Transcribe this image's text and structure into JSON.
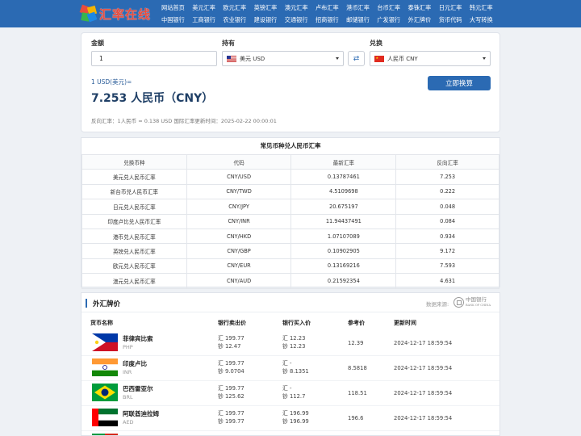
{
  "header": {
    "logo_text": "汇率在线",
    "nav_row1": [
      "网站首页",
      "美元汇率",
      "欧元汇率",
      "英镑汇率",
      "澳元汇率",
      "卢布汇率",
      "港币汇率",
      "台币汇率",
      "泰铢汇率",
      "日元汇率",
      "韩元汇率"
    ],
    "nav_row2": [
      "中国银行",
      "工商银行",
      "农业银行",
      "建设银行",
      "交通银行",
      "招商银行",
      "邮储银行",
      "广发银行",
      "外汇牌价",
      "货币代码",
      "大写转换"
    ]
  },
  "converter": {
    "amount_label": "金额",
    "amount_value": "1",
    "have_label": "持有",
    "have_value": "美元 USD",
    "exchange_label": "兑换",
    "exchange_value": "人民币 CNY",
    "unit_line": "1 USD(美元)=",
    "result": "7.253 人民币（CNY）",
    "convert_button": "立即换算",
    "reverse_line": "反向汇率：1人民币 = 0.138 USD  国际汇率更新时间：2025-02-22 00:00:01"
  },
  "common_rates": {
    "title": "常见币种兑人民币汇率",
    "headers": [
      "兑换币种",
      "代码",
      "最新汇率",
      "反向汇率"
    ],
    "rows": [
      [
        "美元兑人民币汇率",
        "CNY/USD",
        "0.13787461",
        "7.253"
      ],
      [
        "新台币兑人民币汇率",
        "CNY/TWD",
        "4.5109698",
        "0.222"
      ],
      [
        "日元兑人民币汇率",
        "CNY/JPY",
        "20.675197",
        "0.048"
      ],
      [
        "印度卢比兑人民币汇率",
        "CNY/INR",
        "11.94437491",
        "0.084"
      ],
      [
        "港币兑人民币汇率",
        "CNY/HKD",
        "1.07107089",
        "0.934"
      ],
      [
        "英镑兑人民币汇率",
        "CNY/GBP",
        "0.10902905",
        "9.172"
      ],
      [
        "欧元兑人民币汇率",
        "CNY/EUR",
        "0.13169216",
        "7.593"
      ],
      [
        "澳元兑人民币汇率",
        "CNY/AUD",
        "0.21592354",
        "4.631"
      ]
    ]
  },
  "forex": {
    "title": "外汇牌价",
    "source_label": "数据来源:",
    "source_logo": "中国银行",
    "source_logo_en": "BANK OF CHINA",
    "columns": [
      "货币名称",
      "银行卖出价",
      "银行买入价",
      "参考价",
      "更新时间"
    ],
    "rows": [
      {
        "name": "菲律宾比索",
        "code": "PHP",
        "sell_1": "汇 199.77",
        "sell_2": "钞 12.47",
        "buy_1": "汇 12.23",
        "buy_2": "钞 12.23",
        "ref": "12.39",
        "time": "2024-12-17 18:59:54",
        "flag": "php"
      },
      {
        "name": "印度卢比",
        "code": "INR",
        "sell_1": "汇 199.77",
        "sell_2": "钞 9.0704",
        "buy_1": "汇 -",
        "buy_2": "钞 8.1351",
        "ref": "8.5818",
        "time": "2024-12-17 18:59:54",
        "flag": "inr"
      },
      {
        "name": "巴西雷亚尔",
        "code": "BRL",
        "sell_1": "汇 199.77",
        "sell_2": "钞 125.62",
        "buy_1": "汇 -",
        "buy_2": "钞 112.7",
        "ref": "118.51",
        "time": "2024-12-17 18:59:54",
        "flag": "brl"
      },
      {
        "name": "阿联酋迪拉姆",
        "code": "AED",
        "sell_1": "汇 199.77",
        "sell_2": "钞 199.77",
        "buy_1": "汇 196.99",
        "buy_2": "钞 196.99",
        "ref": "196.6",
        "time": "2024-12-17 18:59:54",
        "flag": "aed"
      }
    ]
  },
  "colors": {
    "primary": "#2b6ab3",
    "logo_red": "#e94b3c",
    "page_bg": "#eef1f5"
  }
}
